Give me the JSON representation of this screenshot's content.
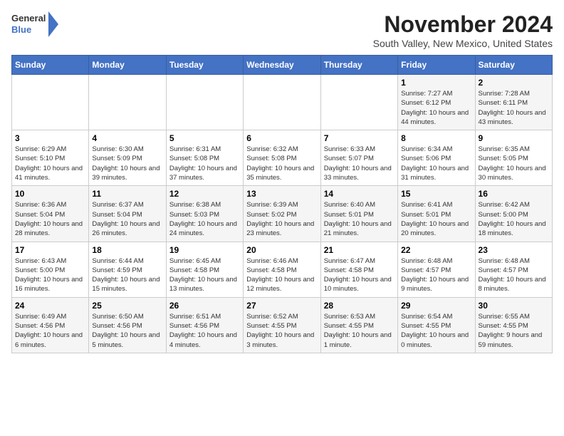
{
  "header": {
    "logo_general": "General",
    "logo_blue": "Blue",
    "title": "November 2024",
    "subtitle": "South Valley, New Mexico, United States"
  },
  "weekdays": [
    "Sunday",
    "Monday",
    "Tuesday",
    "Wednesday",
    "Thursday",
    "Friday",
    "Saturday"
  ],
  "weeks": [
    [
      {
        "day": "",
        "info": ""
      },
      {
        "day": "",
        "info": ""
      },
      {
        "day": "",
        "info": ""
      },
      {
        "day": "",
        "info": ""
      },
      {
        "day": "",
        "info": ""
      },
      {
        "day": "1",
        "info": "Sunrise: 7:27 AM\nSunset: 6:12 PM\nDaylight: 10 hours and 44 minutes."
      },
      {
        "day": "2",
        "info": "Sunrise: 7:28 AM\nSunset: 6:11 PM\nDaylight: 10 hours and 43 minutes."
      }
    ],
    [
      {
        "day": "3",
        "info": "Sunrise: 6:29 AM\nSunset: 5:10 PM\nDaylight: 10 hours and 41 minutes."
      },
      {
        "day": "4",
        "info": "Sunrise: 6:30 AM\nSunset: 5:09 PM\nDaylight: 10 hours and 39 minutes."
      },
      {
        "day": "5",
        "info": "Sunrise: 6:31 AM\nSunset: 5:08 PM\nDaylight: 10 hours and 37 minutes."
      },
      {
        "day": "6",
        "info": "Sunrise: 6:32 AM\nSunset: 5:08 PM\nDaylight: 10 hours and 35 minutes."
      },
      {
        "day": "7",
        "info": "Sunrise: 6:33 AM\nSunset: 5:07 PM\nDaylight: 10 hours and 33 minutes."
      },
      {
        "day": "8",
        "info": "Sunrise: 6:34 AM\nSunset: 5:06 PM\nDaylight: 10 hours and 31 minutes."
      },
      {
        "day": "9",
        "info": "Sunrise: 6:35 AM\nSunset: 5:05 PM\nDaylight: 10 hours and 30 minutes."
      }
    ],
    [
      {
        "day": "10",
        "info": "Sunrise: 6:36 AM\nSunset: 5:04 PM\nDaylight: 10 hours and 28 minutes."
      },
      {
        "day": "11",
        "info": "Sunrise: 6:37 AM\nSunset: 5:04 PM\nDaylight: 10 hours and 26 minutes."
      },
      {
        "day": "12",
        "info": "Sunrise: 6:38 AM\nSunset: 5:03 PM\nDaylight: 10 hours and 24 minutes."
      },
      {
        "day": "13",
        "info": "Sunrise: 6:39 AM\nSunset: 5:02 PM\nDaylight: 10 hours and 23 minutes."
      },
      {
        "day": "14",
        "info": "Sunrise: 6:40 AM\nSunset: 5:01 PM\nDaylight: 10 hours and 21 minutes."
      },
      {
        "day": "15",
        "info": "Sunrise: 6:41 AM\nSunset: 5:01 PM\nDaylight: 10 hours and 20 minutes."
      },
      {
        "day": "16",
        "info": "Sunrise: 6:42 AM\nSunset: 5:00 PM\nDaylight: 10 hours and 18 minutes."
      }
    ],
    [
      {
        "day": "17",
        "info": "Sunrise: 6:43 AM\nSunset: 5:00 PM\nDaylight: 10 hours and 16 minutes."
      },
      {
        "day": "18",
        "info": "Sunrise: 6:44 AM\nSunset: 4:59 PM\nDaylight: 10 hours and 15 minutes."
      },
      {
        "day": "19",
        "info": "Sunrise: 6:45 AM\nSunset: 4:58 PM\nDaylight: 10 hours and 13 minutes."
      },
      {
        "day": "20",
        "info": "Sunrise: 6:46 AM\nSunset: 4:58 PM\nDaylight: 10 hours and 12 minutes."
      },
      {
        "day": "21",
        "info": "Sunrise: 6:47 AM\nSunset: 4:58 PM\nDaylight: 10 hours and 10 minutes."
      },
      {
        "day": "22",
        "info": "Sunrise: 6:48 AM\nSunset: 4:57 PM\nDaylight: 10 hours and 9 minutes."
      },
      {
        "day": "23",
        "info": "Sunrise: 6:48 AM\nSunset: 4:57 PM\nDaylight: 10 hours and 8 minutes."
      }
    ],
    [
      {
        "day": "24",
        "info": "Sunrise: 6:49 AM\nSunset: 4:56 PM\nDaylight: 10 hours and 6 minutes."
      },
      {
        "day": "25",
        "info": "Sunrise: 6:50 AM\nSunset: 4:56 PM\nDaylight: 10 hours and 5 minutes."
      },
      {
        "day": "26",
        "info": "Sunrise: 6:51 AM\nSunset: 4:56 PM\nDaylight: 10 hours and 4 minutes."
      },
      {
        "day": "27",
        "info": "Sunrise: 6:52 AM\nSunset: 4:55 PM\nDaylight: 10 hours and 3 minutes."
      },
      {
        "day": "28",
        "info": "Sunrise: 6:53 AM\nSunset: 4:55 PM\nDaylight: 10 hours and 1 minute."
      },
      {
        "day": "29",
        "info": "Sunrise: 6:54 AM\nSunset: 4:55 PM\nDaylight: 10 hours and 0 minutes."
      },
      {
        "day": "30",
        "info": "Sunrise: 6:55 AM\nSunset: 4:55 PM\nDaylight: 9 hours and 59 minutes."
      }
    ]
  ]
}
